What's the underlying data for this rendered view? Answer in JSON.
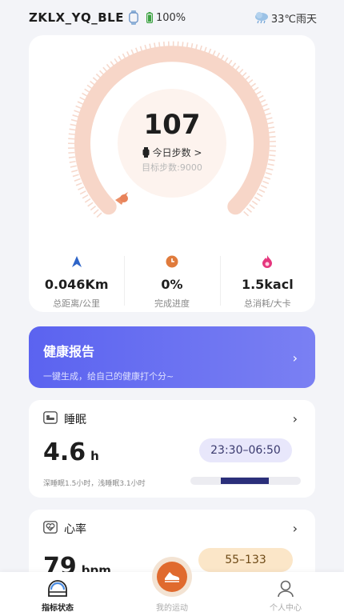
{
  "status_bar": {
    "device_name": "ZKLX_YQ_BLE",
    "battery": "100%",
    "weather": "33℃雨天"
  },
  "steps": {
    "count": "107",
    "today_label": "今日步数 >",
    "goal_label": "目标步数:9000",
    "progress_percent": 1.2,
    "stats": [
      {
        "value": "0.046Km",
        "label": "总距离/公里",
        "icon": "navigation-arrow-icon"
      },
      {
        "value": "0%",
        "label": "完成进度",
        "icon": "clock-icon"
      },
      {
        "value": "1.5kacl",
        "label": "总消耗/大卡",
        "icon": "flame-icon"
      }
    ]
  },
  "report": {
    "title": "健康报告",
    "subtitle": "一键生成，给自己的健康打个分~",
    "arrow": "›"
  },
  "sleep": {
    "title": "睡眠",
    "value": "4.6",
    "unit": "h",
    "time_range": "23:30–06:50",
    "detail": "深睡眠1.5小时，浅睡眠3.1小时",
    "arrow": "›"
  },
  "heart": {
    "title": "心率",
    "value": "79",
    "unit": "bpm",
    "range": "55–133",
    "arrow": "›"
  },
  "tabs": [
    {
      "label": "指标状态",
      "icon": "health-index-icon"
    },
    {
      "label": "我的运动",
      "icon": "running-shoe-icon"
    },
    {
      "label": "个人中心",
      "icon": "person-icon"
    }
  ],
  "colors": {
    "accent": "#5b63f0",
    "gauge": "#f3c7b6",
    "sport": "#e06a2e"
  }
}
